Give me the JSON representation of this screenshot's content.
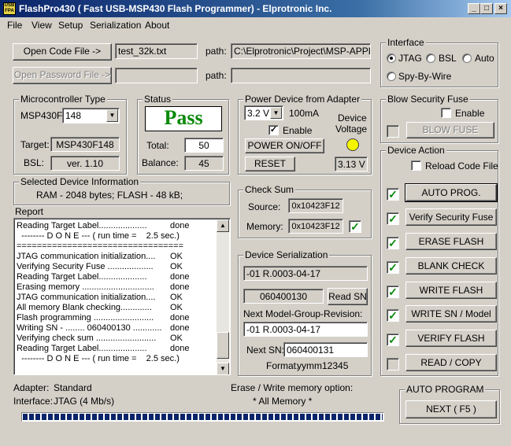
{
  "window": {
    "title": "FlashPro430  ( Fast USB-MSP430 Flash Programmer)  - Elprotronic Inc.",
    "icon_text": "USB FPA"
  },
  "menu": [
    "File",
    "View",
    "Setup",
    "Serialization",
    "About"
  ],
  "files": {
    "open_code_label": "Open Code File      ->",
    "code_file": "test_32k.txt",
    "path_label": "path:",
    "code_path": "C:\\Elprotronic\\Project\\MSP-APPL\\T",
    "open_password_label": "Open Password File ->",
    "password_file": "",
    "password_path": ""
  },
  "interface": {
    "title": "Interface",
    "options": [
      "JTAG",
      "BSL",
      "Auto"
    ],
    "selected": "JTAG",
    "spy_by_wire": "Spy-By-Wire"
  },
  "mcu": {
    "title": "Microcontroller Type",
    "prefix": "MSP430F-",
    "model": "148",
    "target_label": "Target:",
    "target": "MSP430F148",
    "bsl_label": "BSL:",
    "bsl": "ver.  1.10"
  },
  "status": {
    "title": "Status",
    "result": "Pass",
    "total_label": "Total:",
    "total": "50",
    "balance_label": "Balance:",
    "balance": "45"
  },
  "power": {
    "title": "Power Device from Adapter",
    "voltage": "3.2 V",
    "current": "100mA",
    "enable_label": "Enable",
    "device_voltage_label_1": "Device",
    "device_voltage_label_2": "Voltage",
    "on_off_label": "POWER ON/OFF",
    "reset_label": "RESET",
    "measured_voltage": "3.13 V"
  },
  "blow": {
    "title": "Blow Security Fuse",
    "enable_label": "Enable",
    "button_label": "BLOW FUSE"
  },
  "selected_device": {
    "title": "Selected Device Information",
    "info": "RAM  -  2048 bytes;      FLASH - 48 kB;"
  },
  "checksum": {
    "title": "Check Sum",
    "source_label": "Source:",
    "source": "0x10423F12",
    "memory_label": "Memory:",
    "memory": "0x10423F12"
  },
  "report": {
    "title": "Report",
    "lines": [
      {
        "text": "Reading Target Label....................",
        "status": "done"
      },
      {
        "text": "  -------- D O N E --- ( run time =    2.5 sec.)",
        "status": ""
      },
      {
        "text": "=================================",
        "status": ""
      },
      {
        "text": "JTAG communication initialization....",
        "status": "OK"
      },
      {
        "text": "Verifying Security Fuse ...................",
        "status": "OK"
      },
      {
        "text": "Reading Target Label....................",
        "status": "done"
      },
      {
        "text": "Erasing memory ..............................",
        "status": "done"
      },
      {
        "text": "JTAG communication initialization....",
        "status": "OK"
      },
      {
        "text": "All memory Blank checking.............",
        "status": "OK"
      },
      {
        "text": "Flash programming .........................",
        "status": "done"
      },
      {
        "text": "Writing SN - ........ 060400130 ............",
        "status": "done"
      },
      {
        "text": "Verifying check sum .........................",
        "status": "OK"
      },
      {
        "text": "Reading Target Label....................",
        "status": "done"
      },
      {
        "text": "  -------- D O N E --- ( run time =    2.5 sec.)",
        "status": ""
      }
    ]
  },
  "serialization": {
    "title": "Device Serialization",
    "model": "-01 R.0003-04-17",
    "sn": "060400130",
    "read_sn_label": "Read SN",
    "next_model_label": "Next Model-Group-Revision:",
    "next_model": "-01 R.0003-04-17",
    "next_sn_label": "Next SN:",
    "next_sn": "060400131",
    "format_label": "Format:",
    "format": "yymm12345"
  },
  "action": {
    "title": "Device Action",
    "reload_label": "Reload Code File",
    "buttons": [
      {
        "label": "AUTO PROG.",
        "checked": true
      },
      {
        "label": "Verify Security Fuse",
        "checked": true
      },
      {
        "label": "ERASE FLASH",
        "checked": true
      },
      {
        "label": "BLANK CHECK",
        "checked": true
      },
      {
        "label": "WRITE FLASH",
        "checked": true
      },
      {
        "label": "WRITE SN / Model",
        "checked": true
      },
      {
        "label": "VERIFY FLASH",
        "checked": true
      },
      {
        "label": "READ / COPY",
        "checked": false
      }
    ]
  },
  "footer": {
    "adapter_label": "Adapter:",
    "adapter": "Standard",
    "interface_label": "Interface:",
    "interface": "JTAG (4 Mb/s)",
    "erase_label": "Erase / Write memory option:",
    "erase_value": "* All Memory *",
    "progress": 1.0
  },
  "auto_program": {
    "title": "AUTO PROGRAM",
    "next_label": "NEXT  ( F5 )"
  }
}
